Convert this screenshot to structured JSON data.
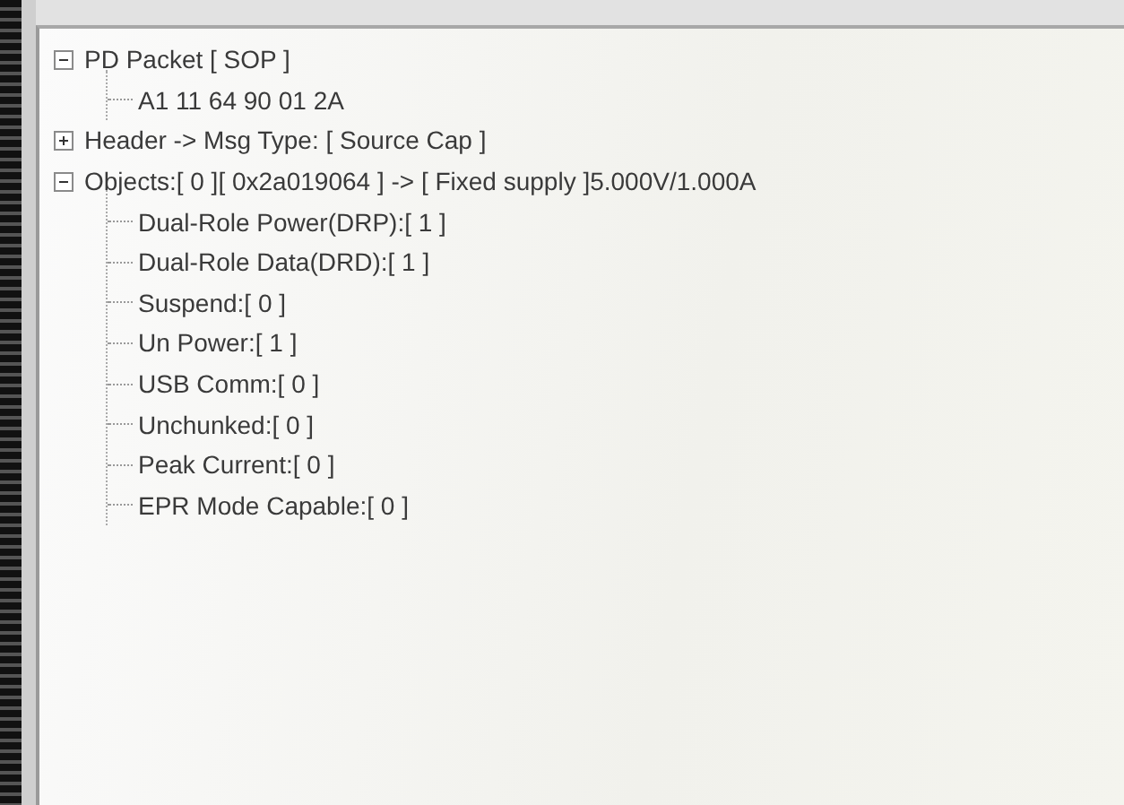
{
  "tree": [
    {
      "label": "PD Packet [ SOP ]",
      "expanded": true,
      "children": [
        {
          "label": "A1 11 64 90 01 2A"
        }
      ]
    },
    {
      "label": "Header -> Msg Type: [ Source Cap ]",
      "expanded": false
    },
    {
      "label": "Objects:[ 0 ][ 0x2a019064 ] -> [ Fixed supply ]5.000V/1.000A",
      "expanded": true,
      "children": [
        {
          "label": "Dual-Role Power(DRP):[ 1 ]"
        },
        {
          "label": "Dual-Role Data(DRD):[ 1 ]"
        },
        {
          "label": "Suspend:[ 0 ]"
        },
        {
          "label": "Un Power:[ 1 ]"
        },
        {
          "label": "USB Comm:[ 0 ]"
        },
        {
          "label": "Unchunked:[ 0 ]"
        },
        {
          "label": "Peak Current:[  0 ]"
        },
        {
          "label": "EPR Mode Capable:[ 0 ]"
        }
      ]
    }
  ]
}
